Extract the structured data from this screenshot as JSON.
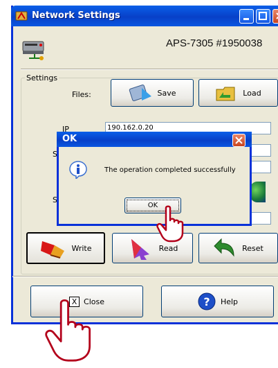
{
  "window": {
    "title": "Network Settings",
    "model": "APS-7305 #1950038"
  },
  "settings": {
    "group_label": "Settings",
    "files_label": "Files:",
    "save_label": "Save",
    "load_label": "Load",
    "ip_value": "190.162.0.20"
  },
  "actions": {
    "write_label": "Write",
    "read_label": "Read",
    "reset_label": "Reset"
  },
  "footer": {
    "close_checkbox_glyph": "X",
    "close_label": "Close",
    "help_label": "Help"
  },
  "dialog": {
    "title": "OK",
    "message": "The operation completed successfully",
    "ok_label": "OK"
  },
  "icons": {
    "title": "network-settings-icon",
    "device": "network-device-icon",
    "save": "save-disk-icon",
    "load": "open-folder-icon",
    "write": "write-eraser-icon",
    "read": "read-arrow-icon",
    "reset": "reset-arrow-icon",
    "help": "help-icon",
    "info": "info-icon",
    "pointer": "hand-pointer-icon"
  },
  "colors": {
    "titlebar": "#0a5fe8",
    "window_bg": "#ece9d8",
    "close_red": "#c8441e",
    "hand_outline": "#b3001b"
  }
}
